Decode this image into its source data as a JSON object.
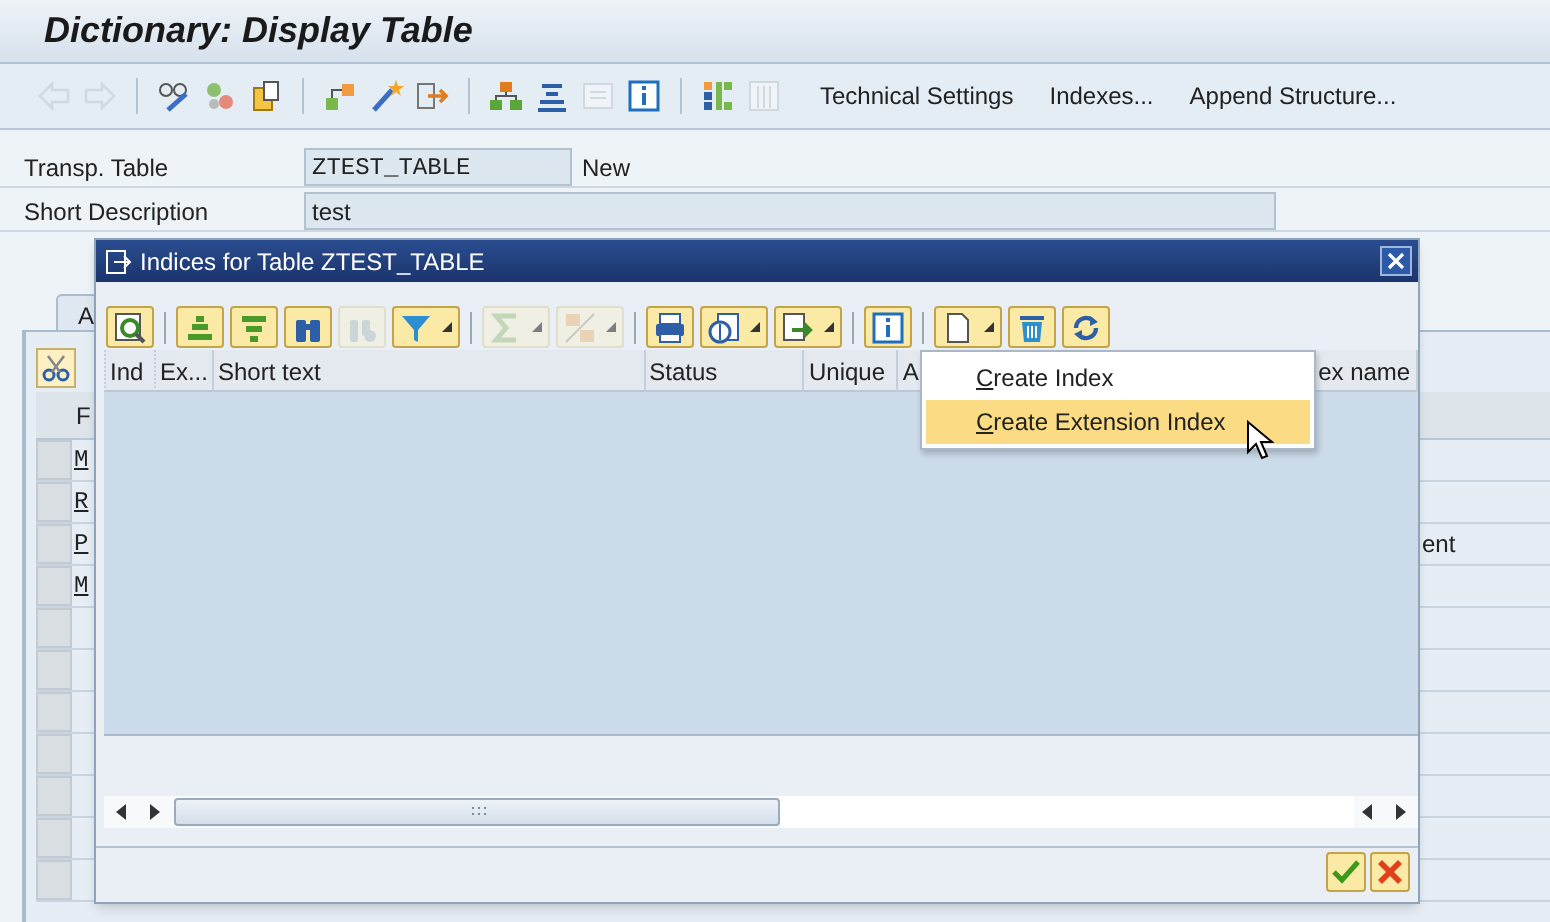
{
  "window": {
    "title": "Dictionary: Display Table"
  },
  "toolbar": {
    "icon_groups": [
      [
        {
          "kind": "back",
          "disabled": true
        },
        {
          "kind": "forward",
          "disabled": true
        }
      ],
      [
        {
          "kind": "edit",
          "disabled": false
        },
        {
          "kind": "toggle",
          "disabled": false
        },
        {
          "kind": "clipboard",
          "disabled": false
        }
      ],
      [
        {
          "kind": "objects",
          "disabled": false
        },
        {
          "kind": "wand",
          "disabled": false
        },
        {
          "kind": "export",
          "disabled": false
        }
      ],
      [
        {
          "kind": "hierarchy",
          "disabled": false
        },
        {
          "kind": "align",
          "disabled": false
        },
        {
          "kind": "list",
          "disabled": true
        },
        {
          "kind": "info",
          "disabled": false
        }
      ],
      [
        {
          "kind": "grid",
          "disabled": false
        },
        {
          "kind": "columns",
          "disabled": true
        }
      ]
    ],
    "buttons": [
      "Technical Settings",
      "Indexes...",
      "Append Structure..."
    ]
  },
  "fields": [
    {
      "label": "Transp. Table",
      "value": "ZTEST_TABLE",
      "note": "New",
      "kind": "short"
    },
    {
      "label": "Short Description",
      "value": "test",
      "kind": "long"
    }
  ],
  "tab": {
    "label": "A"
  },
  "table": {
    "column": "F",
    "rows": [
      "M",
      "R",
      "P",
      "M"
    ],
    "right_text": "ent"
  },
  "dialog": {
    "title": "Indices for Table ZTEST_TABLE",
    "toolbar_groups": [
      [
        {
          "kind": "details",
          "disabled": false,
          "menu": false
        }
      ],
      [
        {
          "kind": "sort-up",
          "disabled": false,
          "menu": false
        },
        {
          "kind": "sort-down",
          "disabled": false,
          "menu": false
        },
        {
          "kind": "find",
          "disabled": false,
          "menu": false
        },
        {
          "kind": "find-next",
          "disabled": true,
          "menu": false
        },
        {
          "kind": "filter",
          "disabled": false,
          "menu": true
        }
      ],
      [
        {
          "kind": "sum",
          "disabled": true,
          "menu": true
        },
        {
          "kind": "subtotal",
          "disabled": true,
          "menu": true
        }
      ],
      [
        {
          "kind": "print",
          "disabled": false,
          "menu": false
        },
        {
          "kind": "view",
          "disabled": false,
          "menu": true
        },
        {
          "kind": "export",
          "disabled": false,
          "menu": true
        }
      ],
      [
        {
          "kind": "info",
          "disabled": false,
          "menu": false
        }
      ],
      [
        {
          "kind": "create",
          "disabled": false,
          "menu": true
        },
        {
          "kind": "delete",
          "disabled": false,
          "menu": false
        },
        {
          "kind": "refresh",
          "disabled": false,
          "menu": false
        }
      ]
    ],
    "columns": [
      "Ind",
      "Ex...",
      "Short text",
      "Status",
      "Unique",
      "A",
      "ex name"
    ],
    "menu": [
      {
        "label": "Create Index",
        "selected": false
      },
      {
        "label": "Create Extension Index",
        "selected": true
      }
    ]
  }
}
